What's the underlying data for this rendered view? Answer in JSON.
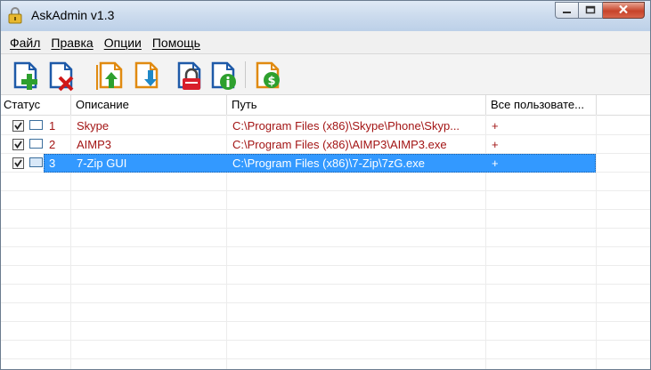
{
  "window": {
    "title": "AskAdmin v1.3",
    "controls": {
      "minimize_icon": "minimize-icon",
      "maximize_icon": "maximize-icon",
      "close_icon": "close-icon"
    }
  },
  "menu": [
    "Файл",
    "Правка",
    "Опции",
    "Помощь"
  ],
  "toolbar": {
    "buttons": [
      {
        "icon": "add-file-icon"
      },
      {
        "icon": "remove-file-icon"
      },
      {
        "icon": "import-icon"
      },
      {
        "icon": "export-icon"
      },
      {
        "icon": "lock-icon"
      },
      {
        "icon": "info-icon"
      },
      {
        "icon": "donate-icon"
      }
    ]
  },
  "table": {
    "columns": [
      "Статус",
      "Описание",
      "Путь",
      "Все пользовате..."
    ],
    "rows": [
      {
        "num": "1",
        "description": "Skype",
        "path": "C:\\Program Files (x86)\\Skype\\Phone\\Skyp...",
        "all_users": "+",
        "checked": true,
        "selected": false
      },
      {
        "num": "2",
        "description": "AIMP3",
        "path": "C:\\Program Files (x86)\\AIMP3\\AIMP3.exe",
        "all_users": "+",
        "checked": true,
        "selected": false
      },
      {
        "num": "3",
        "description": "7-Zip GUI",
        "path": "C:\\Program Files (x86)\\7-Zip\\7zG.exe",
        "all_users": "+",
        "checked": true,
        "selected": true
      }
    ]
  },
  "colors": {
    "text_red": "#a31515",
    "selection": "#3399ff",
    "icon_blue": "#1e5aa8"
  }
}
